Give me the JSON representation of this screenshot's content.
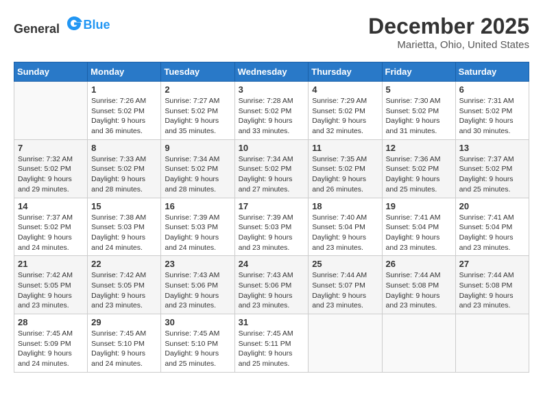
{
  "header": {
    "logo_general": "General",
    "logo_blue": "Blue",
    "month_year": "December 2025",
    "location": "Marietta, Ohio, United States"
  },
  "days_of_week": [
    "Sunday",
    "Monday",
    "Tuesday",
    "Wednesday",
    "Thursday",
    "Friday",
    "Saturday"
  ],
  "weeks": [
    [
      {
        "day": "",
        "sunrise": "",
        "sunset": "",
        "daylight": ""
      },
      {
        "day": "1",
        "sunrise": "Sunrise: 7:26 AM",
        "sunset": "Sunset: 5:02 PM",
        "daylight": "Daylight: 9 hours and 36 minutes."
      },
      {
        "day": "2",
        "sunrise": "Sunrise: 7:27 AM",
        "sunset": "Sunset: 5:02 PM",
        "daylight": "Daylight: 9 hours and 35 minutes."
      },
      {
        "day": "3",
        "sunrise": "Sunrise: 7:28 AM",
        "sunset": "Sunset: 5:02 PM",
        "daylight": "Daylight: 9 hours and 33 minutes."
      },
      {
        "day": "4",
        "sunrise": "Sunrise: 7:29 AM",
        "sunset": "Sunset: 5:02 PM",
        "daylight": "Daylight: 9 hours and 32 minutes."
      },
      {
        "day": "5",
        "sunrise": "Sunrise: 7:30 AM",
        "sunset": "Sunset: 5:02 PM",
        "daylight": "Daylight: 9 hours and 31 minutes."
      },
      {
        "day": "6",
        "sunrise": "Sunrise: 7:31 AM",
        "sunset": "Sunset: 5:02 PM",
        "daylight": "Daylight: 9 hours and 30 minutes."
      }
    ],
    [
      {
        "day": "7",
        "sunrise": "Sunrise: 7:32 AM",
        "sunset": "Sunset: 5:02 PM",
        "daylight": "Daylight: 9 hours and 29 minutes."
      },
      {
        "day": "8",
        "sunrise": "Sunrise: 7:33 AM",
        "sunset": "Sunset: 5:02 PM",
        "daylight": "Daylight: 9 hours and 28 minutes."
      },
      {
        "day": "9",
        "sunrise": "Sunrise: 7:34 AM",
        "sunset": "Sunset: 5:02 PM",
        "daylight": "Daylight: 9 hours and 28 minutes."
      },
      {
        "day": "10",
        "sunrise": "Sunrise: 7:34 AM",
        "sunset": "Sunset: 5:02 PM",
        "daylight": "Daylight: 9 hours and 27 minutes."
      },
      {
        "day": "11",
        "sunrise": "Sunrise: 7:35 AM",
        "sunset": "Sunset: 5:02 PM",
        "daylight": "Daylight: 9 hours and 26 minutes."
      },
      {
        "day": "12",
        "sunrise": "Sunrise: 7:36 AM",
        "sunset": "Sunset: 5:02 PM",
        "daylight": "Daylight: 9 hours and 25 minutes."
      },
      {
        "day": "13",
        "sunrise": "Sunrise: 7:37 AM",
        "sunset": "Sunset: 5:02 PM",
        "daylight": "Daylight: 9 hours and 25 minutes."
      }
    ],
    [
      {
        "day": "14",
        "sunrise": "Sunrise: 7:37 AM",
        "sunset": "Sunset: 5:02 PM",
        "daylight": "Daylight: 9 hours and 24 minutes."
      },
      {
        "day": "15",
        "sunrise": "Sunrise: 7:38 AM",
        "sunset": "Sunset: 5:03 PM",
        "daylight": "Daylight: 9 hours and 24 minutes."
      },
      {
        "day": "16",
        "sunrise": "Sunrise: 7:39 AM",
        "sunset": "Sunset: 5:03 PM",
        "daylight": "Daylight: 9 hours and 24 minutes."
      },
      {
        "day": "17",
        "sunrise": "Sunrise: 7:39 AM",
        "sunset": "Sunset: 5:03 PM",
        "daylight": "Daylight: 9 hours and 23 minutes."
      },
      {
        "day": "18",
        "sunrise": "Sunrise: 7:40 AM",
        "sunset": "Sunset: 5:04 PM",
        "daylight": "Daylight: 9 hours and 23 minutes."
      },
      {
        "day": "19",
        "sunrise": "Sunrise: 7:41 AM",
        "sunset": "Sunset: 5:04 PM",
        "daylight": "Daylight: 9 hours and 23 minutes."
      },
      {
        "day": "20",
        "sunrise": "Sunrise: 7:41 AM",
        "sunset": "Sunset: 5:04 PM",
        "daylight": "Daylight: 9 hours and 23 minutes."
      }
    ],
    [
      {
        "day": "21",
        "sunrise": "Sunrise: 7:42 AM",
        "sunset": "Sunset: 5:05 PM",
        "daylight": "Daylight: 9 hours and 23 minutes."
      },
      {
        "day": "22",
        "sunrise": "Sunrise: 7:42 AM",
        "sunset": "Sunset: 5:05 PM",
        "daylight": "Daylight: 9 hours and 23 minutes."
      },
      {
        "day": "23",
        "sunrise": "Sunrise: 7:43 AM",
        "sunset": "Sunset: 5:06 PM",
        "daylight": "Daylight: 9 hours and 23 minutes."
      },
      {
        "day": "24",
        "sunrise": "Sunrise: 7:43 AM",
        "sunset": "Sunset: 5:06 PM",
        "daylight": "Daylight: 9 hours and 23 minutes."
      },
      {
        "day": "25",
        "sunrise": "Sunrise: 7:44 AM",
        "sunset": "Sunset: 5:07 PM",
        "daylight": "Daylight: 9 hours and 23 minutes."
      },
      {
        "day": "26",
        "sunrise": "Sunrise: 7:44 AM",
        "sunset": "Sunset: 5:08 PM",
        "daylight": "Daylight: 9 hours and 23 minutes."
      },
      {
        "day": "27",
        "sunrise": "Sunrise: 7:44 AM",
        "sunset": "Sunset: 5:08 PM",
        "daylight": "Daylight: 9 hours and 23 minutes."
      }
    ],
    [
      {
        "day": "28",
        "sunrise": "Sunrise: 7:45 AM",
        "sunset": "Sunset: 5:09 PM",
        "daylight": "Daylight: 9 hours and 24 minutes."
      },
      {
        "day": "29",
        "sunrise": "Sunrise: 7:45 AM",
        "sunset": "Sunset: 5:10 PM",
        "daylight": "Daylight: 9 hours and 24 minutes."
      },
      {
        "day": "30",
        "sunrise": "Sunrise: 7:45 AM",
        "sunset": "Sunset: 5:10 PM",
        "daylight": "Daylight: 9 hours and 25 minutes."
      },
      {
        "day": "31",
        "sunrise": "Sunrise: 7:45 AM",
        "sunset": "Sunset: 5:11 PM",
        "daylight": "Daylight: 9 hours and 25 minutes."
      },
      {
        "day": "",
        "sunrise": "",
        "sunset": "",
        "daylight": ""
      },
      {
        "day": "",
        "sunrise": "",
        "sunset": "",
        "daylight": ""
      },
      {
        "day": "",
        "sunrise": "",
        "sunset": "",
        "daylight": ""
      }
    ]
  ]
}
